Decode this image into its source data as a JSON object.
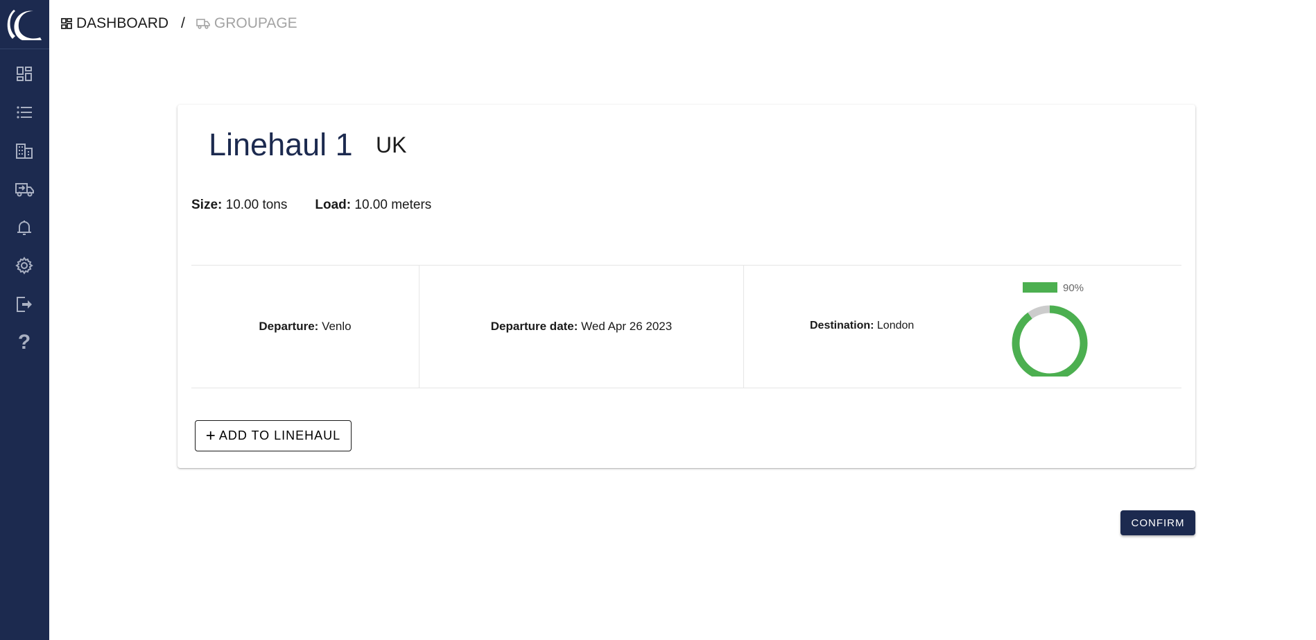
{
  "breadcrumb": {
    "home": "DASHBOARD",
    "separator": "/",
    "current": "GROUPAGE"
  },
  "sidebar": {
    "items": [
      {
        "icon": "dashboard-icon"
      },
      {
        "icon": "list-icon"
      },
      {
        "icon": "building-icon"
      },
      {
        "icon": "truck-icon"
      },
      {
        "icon": "bell-icon"
      },
      {
        "icon": "gear-icon"
      },
      {
        "icon": "logout-icon"
      },
      {
        "icon": "help-icon"
      }
    ]
  },
  "card": {
    "title": "Linehaul 1",
    "region": "UK",
    "size_label": "Size:",
    "size_value": "10.00 tons",
    "load_label": "Load:",
    "load_value": "10.00 meters",
    "departure_label": "Departure:",
    "departure_value": "Venlo",
    "date_label": "Departure date:",
    "date_value": "Wed Apr 26 2023",
    "destination_label": "Destination:",
    "destination_value": "London",
    "add_button": "ADD TO LINEHAUL"
  },
  "chart_data": {
    "type": "pie",
    "variant": "doughnut",
    "values": [
      90,
      10
    ],
    "legend": [
      "90%"
    ],
    "legend_placement": "top",
    "colors": [
      "#4caf50",
      "#cccccc"
    ]
  },
  "confirm_button": "CONFIRM",
  "colors": {
    "sidebar": "#1c2a4f",
    "accent": "#1c2a4f",
    "progress": "#4caf50"
  }
}
